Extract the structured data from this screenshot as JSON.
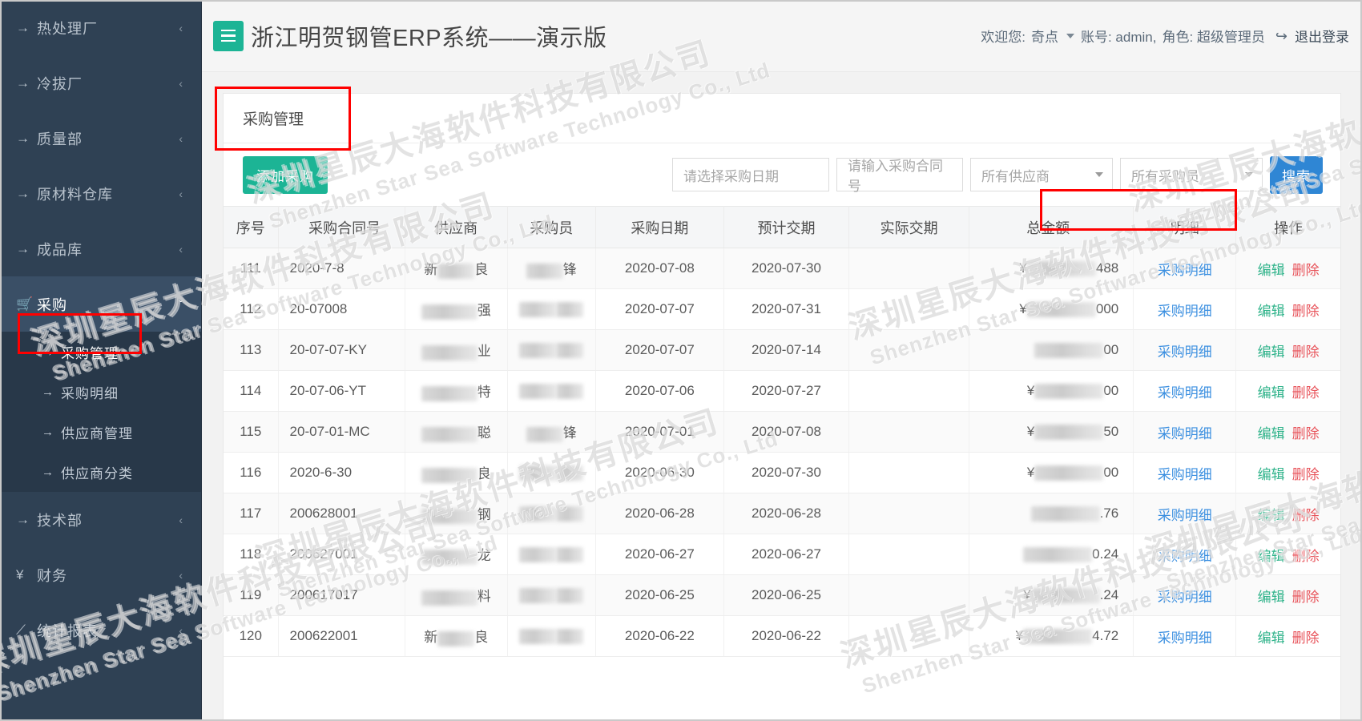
{
  "sidebar": {
    "groups": [
      {
        "icon": "arrow-right-icon",
        "label": "热处理厂",
        "caret": "chevron-left-icon",
        "state": "collapsed"
      },
      {
        "icon": "arrow-right-icon",
        "label": "冷拔厂",
        "caret": "chevron-left-icon",
        "state": "collapsed"
      },
      {
        "icon": "arrow-right-icon",
        "label": "质量部",
        "caret": "chevron-left-icon",
        "state": "collapsed"
      },
      {
        "icon": "arrow-right-icon",
        "label": "原材料仓库",
        "caret": "chevron-left-icon",
        "state": "collapsed"
      },
      {
        "icon": "arrow-right-icon",
        "label": "成品库",
        "caret": "chevron-left-icon",
        "state": "collapsed"
      },
      {
        "icon": "cart-icon",
        "label": "采购",
        "caret": "chevron-down-icon",
        "state": "expanded"
      }
    ],
    "submenu": [
      {
        "icon": "arrow-right-icon",
        "label": "采购管理",
        "active": true
      },
      {
        "icon": "arrow-right-icon",
        "label": "采购明细",
        "active": false
      },
      {
        "icon": "arrow-right-icon",
        "label": "供应商管理",
        "active": false
      },
      {
        "icon": "arrow-right-icon",
        "label": "供应商分类",
        "active": false
      }
    ],
    "groups_after": [
      {
        "icon": "arrow-right-icon",
        "label": "技术部",
        "caret": "chevron-left-icon",
        "state": "collapsed"
      },
      {
        "icon": "yen-icon",
        "label": "财务",
        "caret": "chevron-left-icon",
        "state": "collapsed"
      },
      {
        "icon": "chart-icon",
        "label": "统计报表",
        "caret": "chevron-left-icon",
        "state": "collapsed"
      }
    ]
  },
  "topbar": {
    "menu_icon": "hamburger-icon",
    "title": "浙江明贺钢管ERP系统——演示版",
    "welcome_label": "欢迎您:",
    "user_name": "奇点",
    "account_label": "账号: admin,",
    "role_label": "角色: 超级管理员",
    "logout_icon": "sign-out-icon",
    "logout_label": "退出登录"
  },
  "page": {
    "card_title": "采购管理",
    "add_button": "添加采购",
    "filters": {
      "date_placeholder": "请选择采购日期",
      "contract_placeholder": "请输入采购合同号",
      "supplier_selected": "所有供应商",
      "buyer_selected": "所有采购员"
    },
    "search_button": "搜索"
  },
  "table": {
    "columns": [
      "序号",
      "采购合同号",
      "供应商",
      "采购员",
      "采购日期",
      "预计交期",
      "实际交期",
      "总金额",
      "明细",
      "操作"
    ],
    "detail_link": "采购明细",
    "edit_link": "编辑",
    "delete_link": "删除",
    "rows": [
      {
        "idx": "111",
        "code": "2020-7-8",
        "supplier_prefix": "新",
        "supplier_suffix": "良",
        "buyer_suffix": "锋",
        "purchase_date": "2020-07-08",
        "expected_date": "2020-07-30",
        "actual_date": "",
        "amount_prefix": "¥",
        "amount_tail": "488"
      },
      {
        "idx": "112",
        "code": "20-07008",
        "supplier_prefix": "",
        "supplier_suffix": "强",
        "buyer_suffix": "",
        "purchase_date": "2020-07-07",
        "expected_date": "2020-07-31",
        "actual_date": "",
        "amount_prefix": "¥",
        "amount_tail": "000"
      },
      {
        "idx": "113",
        "code": "20-07-07-KY",
        "supplier_prefix": "",
        "supplier_suffix": "业",
        "buyer_suffix": "",
        "purchase_date": "2020-07-07",
        "expected_date": "2020-07-14",
        "actual_date": "",
        "amount_prefix": "",
        "amount_tail": "00"
      },
      {
        "idx": "114",
        "code": "20-07-06-YT",
        "supplier_prefix": "",
        "supplier_suffix": "特",
        "buyer_suffix": "",
        "purchase_date": "2020-07-06",
        "expected_date": "2020-07-27",
        "actual_date": "",
        "amount_prefix": "¥",
        "amount_tail": "00"
      },
      {
        "idx": "115",
        "code": "20-07-01-MC",
        "supplier_prefix": "",
        "supplier_suffix": "聪",
        "buyer_suffix": "锋",
        "purchase_date": "2020-07-01",
        "expected_date": "2020-07-08",
        "actual_date": "",
        "amount_prefix": "¥",
        "amount_tail": "50"
      },
      {
        "idx": "116",
        "code": "2020-6-30",
        "supplier_prefix": "",
        "supplier_suffix": "良",
        "buyer_suffix": "",
        "purchase_date": "2020-06-30",
        "expected_date": "2020-07-30",
        "actual_date": "",
        "amount_prefix": "¥",
        "amount_tail": "00"
      },
      {
        "idx": "117",
        "code": "200628001",
        "supplier_prefix": "",
        "supplier_suffix": "钢",
        "buyer_suffix": "",
        "purchase_date": "2020-06-28",
        "expected_date": "2020-06-28",
        "actual_date": "",
        "amount_prefix": "",
        "amount_tail": ".76"
      },
      {
        "idx": "118",
        "code": "200627001",
        "supplier_prefix": "",
        "supplier_suffix": "龙",
        "buyer_suffix": "",
        "purchase_date": "2020-06-27",
        "expected_date": "2020-06-27",
        "actual_date": "",
        "amount_prefix": "",
        "amount_tail": "0.24"
      },
      {
        "idx": "119",
        "code": "200617017",
        "supplier_prefix": "",
        "supplier_suffix": "料",
        "buyer_suffix": "",
        "purchase_date": "2020-06-25",
        "expected_date": "2020-06-25",
        "actual_date": "",
        "amount_prefix": "¥",
        "amount_tail": ".24"
      },
      {
        "idx": "120",
        "code": "200622001",
        "supplier_prefix": "新",
        "supplier_suffix": "良",
        "buyer_suffix": "",
        "purchase_date": "2020-06-22",
        "expected_date": "2020-06-22",
        "actual_date": "",
        "amount_prefix": "¥",
        "amount_tail": "4.72"
      }
    ]
  },
  "watermark": {
    "line1": "深圳星辰大海软件科技有限公司",
    "line2": "Shenzhen Star Sea Software Technology Co., Ltd"
  },
  "colors": {
    "sidebar_bg": "#2f4154",
    "accent_green": "#1cb495",
    "accent_blue": "#2f86d4",
    "link_blue": "#3b8fe0",
    "edit_green": "#2fb38a",
    "delete_red": "#e8545b",
    "annotation_red": "#ff0000"
  }
}
